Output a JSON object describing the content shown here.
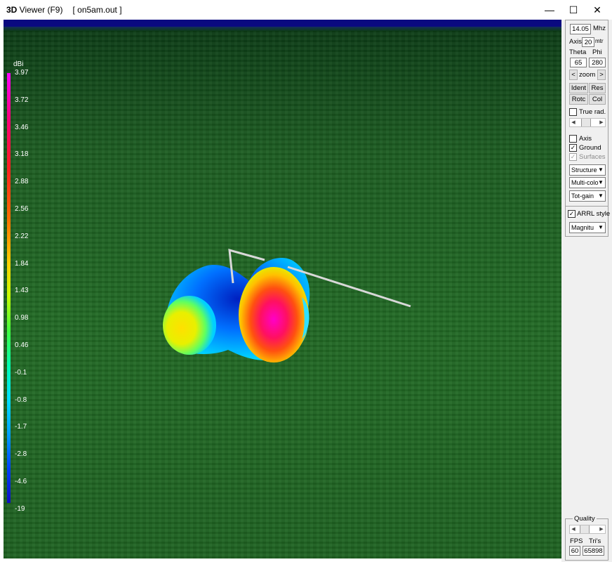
{
  "window": {
    "title_app_bold": "3D",
    "title_app_rest": " Viewer (F9)",
    "title_file": "[   on5am.out ]",
    "minimize": "—",
    "maximize": "☐",
    "close": "✕"
  },
  "legend": {
    "unit": "dBi",
    "labels": [
      "3.97",
      "3.72",
      "3.46",
      "3.18",
      "2.88",
      "2.56",
      "2.22",
      "1.84",
      "1.43",
      "0.98",
      "0.46",
      "-0.1",
      "-0.8",
      "-1.7",
      "-2.8",
      "-4.6",
      "-19"
    ]
  },
  "panel": {
    "freq_value": "14.05",
    "freq_unit": "Mhz",
    "axis_label": "Axis",
    "axis_value": "20",
    "axis_unit": "mtr",
    "theta_label": "Theta",
    "phi_label": "Phi",
    "theta_value": "65",
    "phi_value": "280",
    "zoom_left": "<",
    "zoom_label": "zoom",
    "zoom_right": ">",
    "ident_label": "Ident",
    "res_label": "Res",
    "rotc_label": "Rotc",
    "col_label": "Col",
    "true_rad_label": "True rad.",
    "axis_chk_label": "Axis",
    "ground_label": "Ground",
    "surfaces_label": "Surfaces",
    "structure_select": "Structure",
    "color_select": "Multi-colo",
    "gain_select": "Tot-gain",
    "arrl_label": "ARRL style",
    "magnitude_select": "Magnitu",
    "quality_label": "Quality",
    "fps_label": "FPS",
    "tris_label": "Tri's",
    "fps_value": "60",
    "tris_value": "65898",
    "checked_mark": "✓"
  }
}
